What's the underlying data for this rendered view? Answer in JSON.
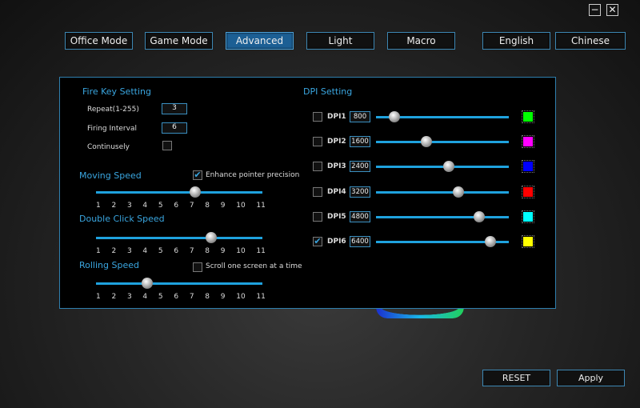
{
  "window": {
    "minimize": "−",
    "close": "✕"
  },
  "tabs": [
    {
      "label": "Office Mode"
    },
    {
      "label": "Game Mode"
    },
    {
      "label": "Advanced"
    },
    {
      "label": "Light"
    },
    {
      "label": "Macro"
    }
  ],
  "languages": [
    {
      "label": "English"
    },
    {
      "label": "Chinese"
    }
  ],
  "fire_key": {
    "title": "Fire Key Setting",
    "repeat_label": "Repeat(1-255)",
    "repeat_value": "3",
    "interval_label": "Firing Interval",
    "interval_value": "6",
    "continuous_label": "Continusely",
    "continuous_checked": false
  },
  "moving_speed": {
    "title": "Moving Speed",
    "enhance_label": "Enhance pointer precision",
    "enhance_checked": true,
    "value": 7
  },
  "double_click": {
    "title": "Double Click Speed",
    "value": 8
  },
  "rolling": {
    "title": "Rolling Speed",
    "scroll_label": "Scroll one screen at a time",
    "scroll_checked": false,
    "value": 4
  },
  "ticks": [
    "1",
    "2",
    "3",
    "4",
    "5",
    "6",
    "7",
    "8",
    "9",
    "10",
    "11"
  ],
  "dpi": {
    "title": "DPI Setting",
    "rows": [
      {
        "label": "DPI1",
        "value": "800",
        "checked": false,
        "fill": 0.14,
        "color": "#00ff00"
      },
      {
        "label": "DPI2",
        "value": "1600",
        "checked": false,
        "fill": 0.38,
        "color": "#ff00ff"
      },
      {
        "label": "DPI3",
        "value": "2400",
        "checked": false,
        "fill": 0.55,
        "color": "#0000ff"
      },
      {
        "label": "DPI4",
        "value": "3200",
        "checked": false,
        "fill": 0.62,
        "color": "#ff0000"
      },
      {
        "label": "DPI5",
        "value": "4800",
        "checked": false,
        "fill": 0.78,
        "color": "#00ffff"
      },
      {
        "label": "DPI6",
        "value": "6400",
        "checked": true,
        "fill": 0.86,
        "color": "#ffff00"
      }
    ]
  },
  "footer": {
    "reset": "RESET",
    "apply": "Apply"
  }
}
